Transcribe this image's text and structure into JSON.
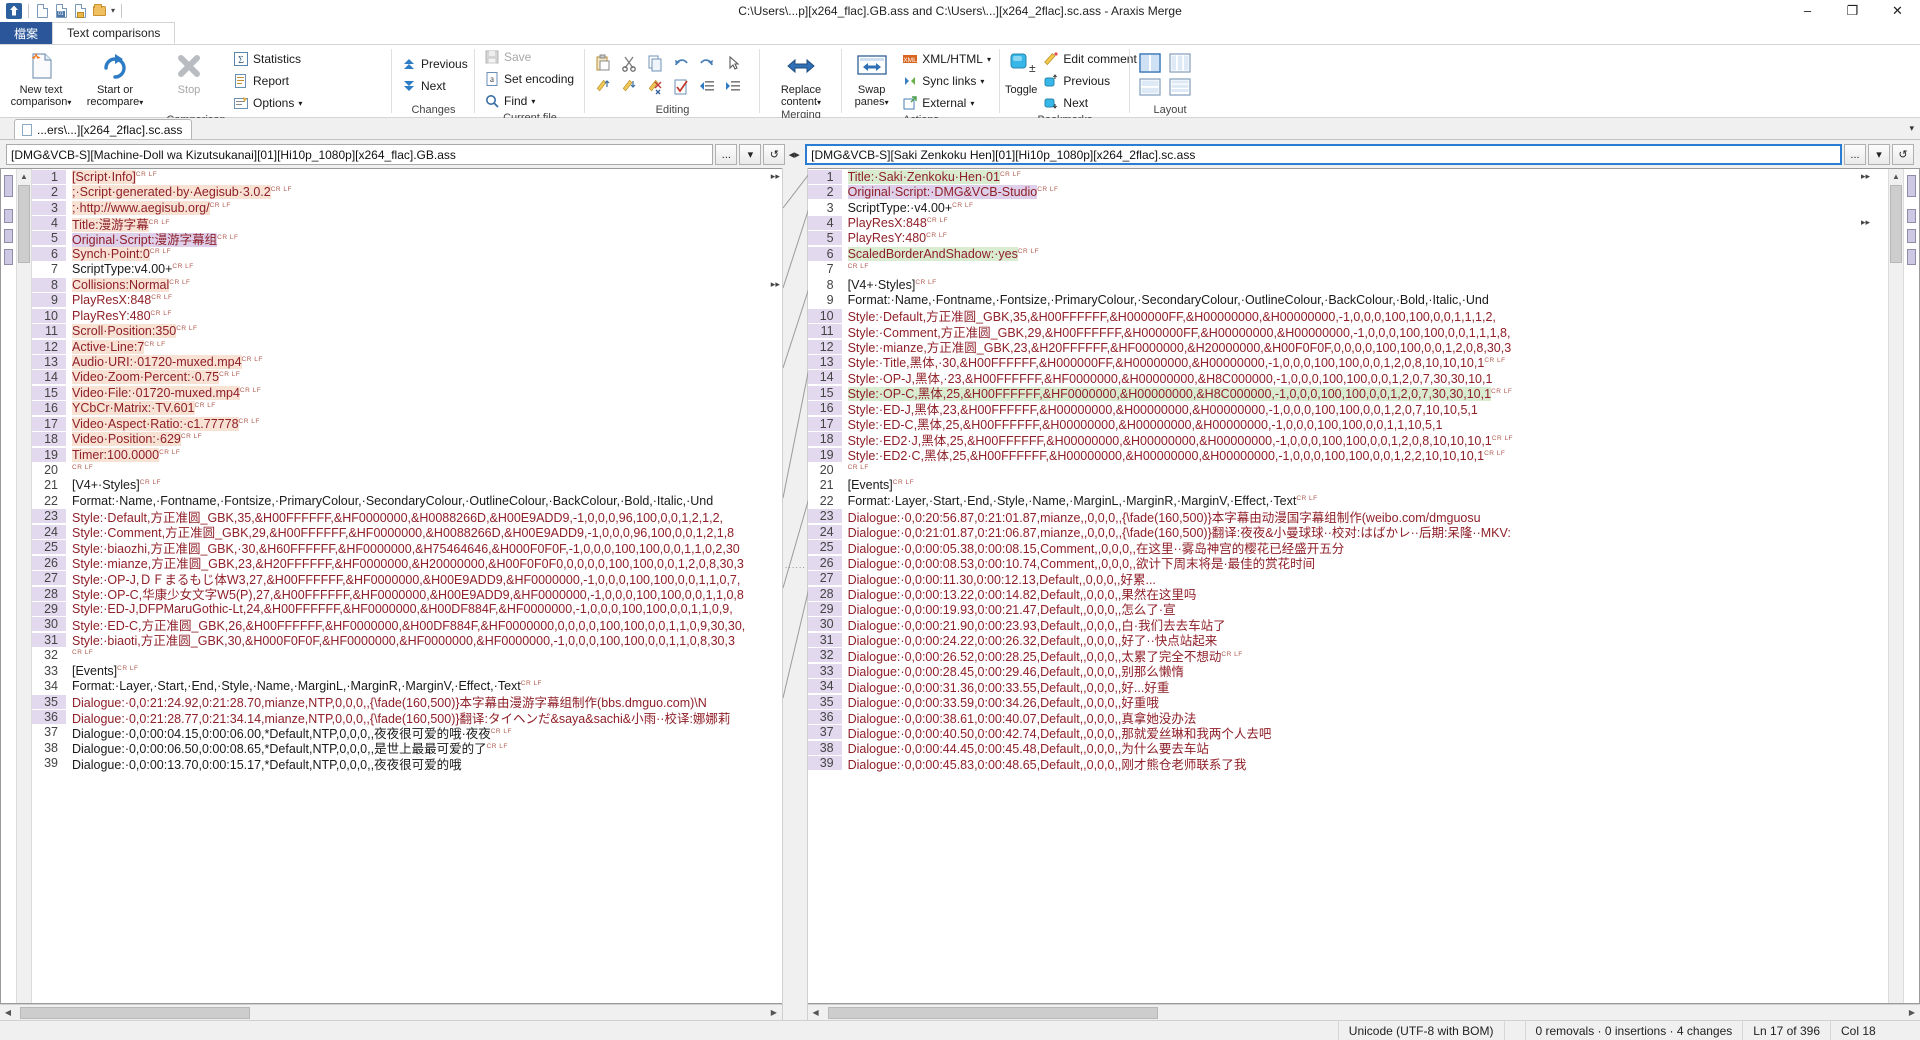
{
  "window": {
    "title": "C:\\Users\\...p][x264_flac].GB.ass and C:\\Users\\...][x264_2flac].sc.ass - Araxis Merge",
    "minimize": "–",
    "maximize": "❐",
    "close": "✕"
  },
  "ribbon_tabs": {
    "file": "檔案",
    "text_comparisons": "Text comparisons"
  },
  "ribbon": {
    "groups": [
      {
        "label": "Comparison",
        "big_buttons": [
          {
            "name": "new-text-comparison",
            "line1": "New text",
            "line2": "comparison",
            "caret": "▾",
            "disabled": false
          },
          {
            "name": "start-or-recompare",
            "line1": "Start or",
            "line2": "recompare",
            "caret": "▾",
            "disabled": false
          },
          {
            "name": "stop",
            "line1": "Stop",
            "line2": "",
            "caret": "",
            "disabled": true
          }
        ],
        "small_items": [
          {
            "label": "Statistics",
            "icon": "sigma-icon",
            "caret": ""
          },
          {
            "label": "Report",
            "icon": "report-icon",
            "caret": ""
          },
          {
            "label": "Options",
            "icon": "options-icon",
            "caret": "▾"
          }
        ]
      },
      {
        "label": "Changes",
        "small_items": [
          {
            "label": "Previous",
            "icon": "arrow-up-icon",
            "caret": ""
          },
          {
            "label": "Next",
            "icon": "arrow-down-icon",
            "caret": ""
          }
        ]
      },
      {
        "label": "Current file",
        "small_items": [
          {
            "label": "Save",
            "icon": "save-icon",
            "caret": "",
            "disabled": true
          },
          {
            "label": "Set encoding",
            "icon": "encoding-icon",
            "caret": ""
          },
          {
            "label": "Find",
            "icon": "search-icon",
            "caret": "▾"
          }
        ]
      },
      {
        "label": "Editing",
        "icons": [
          "paste-icon",
          "cut-icon",
          "copy-icon",
          "undo-icon",
          "redo-icon",
          "select-icon",
          "edit-up-icon",
          "edit-down-icon",
          "edit-clear-icon",
          "check-edit-icon",
          "outdent-icon",
          "indent-icon"
        ]
      },
      {
        "label": "Merging",
        "big_buttons": [
          {
            "name": "replace-content",
            "line1": "Replace",
            "line2": "content",
            "caret": "▾",
            "disabled": false
          }
        ]
      },
      {
        "label": "Actions",
        "big_buttons": [
          {
            "name": "swap-panes",
            "line1": "Swap",
            "line2": "panes",
            "caret": "▾",
            "disabled": false
          }
        ],
        "small_items": [
          {
            "label": "XML/HTML",
            "icon": "xml-icon",
            "caret": "▾"
          },
          {
            "label": "Sync links",
            "icon": "sync-links-icon",
            "caret": "▾"
          },
          {
            "label": "External",
            "icon": "external-icon",
            "caret": "▾"
          }
        ]
      },
      {
        "label": "Bookmarks",
        "big_buttons": [
          {
            "name": "toggle-bookmark",
            "line1": "Toggle",
            "line2": "",
            "caret": "",
            "disabled": false
          }
        ],
        "small_items": [
          {
            "label": "Edit comment",
            "icon": "edit-comment-icon",
            "caret": ""
          },
          {
            "label": "Previous",
            "icon": "bookmark-prev-icon",
            "caret": ""
          },
          {
            "label": "Next",
            "icon": "bookmark-next-icon",
            "caret": ""
          }
        ]
      },
      {
        "label": "Layout",
        "icons": [
          "two-pane-icon",
          "three-pane-icon",
          "split-horizontal-icon",
          "stacked-icon"
        ]
      }
    ]
  },
  "file_tab": {
    "label": "...ers\\...][x264_2flac].sc.ass",
    "icon": "document-icon"
  },
  "paths": {
    "left": {
      "value": "[DMG&VCB-S][Machine-Doll wa Kizutsukanai][01][Hi10p_1080p][x264_flac].GB.ass",
      "browse": "...",
      "dropdown": "▾",
      "refresh": "↺"
    },
    "right": {
      "value": "[DMG&VCB-S][Saki Zenkoku Hen][01][Hi10p_1080p][x264_2flac].sc.ass",
      "browse": "...",
      "dropdown": "▾",
      "refresh": "↺"
    },
    "swap_glyph": "◂▸"
  },
  "left_pane": {
    "lines": [
      {
        "n": "1",
        "text": "[Script·Info]",
        "crlf": true,
        "state": "chg",
        "hl": "hl"
      },
      {
        "n": "2",
        "text": ";·Script·generated·by·Aegisub·3.0.2",
        "crlf": true,
        "state": "chg",
        "hl": "hl"
      },
      {
        "n": "3",
        "text": ";·http://www.aegisub.org/",
        "crlf": true,
        "state": "chg",
        "hl": "hl"
      },
      {
        "n": "4",
        "text": "Title:漫游字幕",
        "crlf": true,
        "state": "chg",
        "hl": "hl"
      },
      {
        "n": "5",
        "text": "Original·Script:漫游字幕组",
        "crlf": true,
        "state": "chg",
        "hl": "hl2"
      },
      {
        "n": "6",
        "text": "Synch·Point:0",
        "crlf": true,
        "state": "chg",
        "hl": "hl"
      },
      {
        "n": "7",
        "text": "ScriptType:v4.00+",
        "crlf": true,
        "state": "same",
        "hl": ""
      },
      {
        "n": "8",
        "text": "Collisions:Normal",
        "crlf": true,
        "state": "chg",
        "hl": "hl"
      },
      {
        "n": "9",
        "text": "PlayResX:848",
        "crlf": true,
        "state": "chg",
        "hl": ""
      },
      {
        "n": "10",
        "text": "PlayResY:480",
        "crlf": true,
        "state": "chg",
        "hl": ""
      },
      {
        "n": "11",
        "text": "Scroll·Position:350",
        "crlf": true,
        "state": "chg",
        "hl": "hl"
      },
      {
        "n": "12",
        "text": "Active·Line:7",
        "crlf": true,
        "state": "chg",
        "hl": "hl"
      },
      {
        "n": "13",
        "text": "Audio·URI:·01720-muxed.mp4",
        "crlf": true,
        "state": "chg",
        "hl": "hl"
      },
      {
        "n": "14",
        "text": "Video·Zoom·Percent:·0.75",
        "crlf": true,
        "state": "chg",
        "hl": "hl"
      },
      {
        "n": "15",
        "text": "Video·File:·01720-muxed.mp4",
        "crlf": true,
        "state": "chg",
        "hl": "hl"
      },
      {
        "n": "16",
        "text": "YCbCr·Matrix:·TV.601",
        "crlf": true,
        "state": "chg",
        "hl": "hl"
      },
      {
        "n": "17",
        "text": "Video·Aspect·Ratio:·c1.77778",
        "crlf": true,
        "state": "chg",
        "hl": "hl"
      },
      {
        "n": "18",
        "text": "Video·Position:·629",
        "crlf": true,
        "state": "chg",
        "hl": "hl"
      },
      {
        "n": "19",
        "text": "Timer:100.0000",
        "crlf": true,
        "state": "chg",
        "hl": "hl"
      },
      {
        "n": "20",
        "text": "",
        "crlf": true,
        "state": "same",
        "hl": ""
      },
      {
        "n": "21",
        "text": "[V4+·Styles]",
        "crlf": true,
        "state": "same",
        "hl": ""
      },
      {
        "n": "22",
        "text": "Format:·Name,·Fontname,·Fontsize,·PrimaryColour,·SecondaryColour,·OutlineColour,·BackColour,·Bold,·Italic,·Und",
        "crlf": false,
        "state": "same",
        "hl": ""
      },
      {
        "n": "23",
        "text": "Style:·Default,方正准圆_GBK,35,&H00FFFFFF,&HF0000000,&H0088266D,&H00E9ADD9,-1,0,0,0,96,100,0,0,1,2,1,2,",
        "crlf": false,
        "state": "chg",
        "hl": ""
      },
      {
        "n": "24",
        "text": "Style:·Comment,方正准圆_GBK,29,&H00FFFFFF,&HF0000000,&H0088266D,&H00E9ADD9,-1,0,0,0,96,100,0,0,1,2,1,8",
        "crlf": false,
        "state": "chg",
        "hl": ""
      },
      {
        "n": "25",
        "text": "Style:·biaozhi,方正准圆_GBK,·30,&H60FFFFFF,&HF0000000,&H75464646,&H000F0F0F,-1,0,0,0,100,100,0,0,1,1,0,2,30",
        "crlf": false,
        "state": "chg",
        "hl": ""
      },
      {
        "n": "26",
        "text": "Style:·mianze,方正准圆_GBK,23,&H20FFFFFF,&HF0000000,&H20000000,&H00F0F0F0,0,0,0,0,100,100,0,0,1,2,0,8,30,3",
        "crlf": false,
        "state": "chg",
        "hl": ""
      },
      {
        "n": "27",
        "text": "Style:·OP-J,ＤＦまるもじ体W3,27,&H00FFFFFF,&HF0000000,&H00E9ADD9,&HF0000000,-1,0,0,0,100,100,0,0,1,1,0,7,",
        "crlf": false,
        "state": "chg",
        "hl": ""
      },
      {
        "n": "28",
        "text": "Style:·OP-C,华康少女文字W5(P),27,&H00FFFFFF,&HF0000000,&H00E9ADD9,&HF0000000,-1,0,0,0,100,100,0,0,1,1,0,8",
        "crlf": false,
        "state": "chg",
        "hl": ""
      },
      {
        "n": "29",
        "text": "Style:·ED-J,DFPMaruGothic-Lt,24,&H00FFFFFF,&HF0000000,&H00DF884F,&HF0000000,-1,0,0,0,100,100,0,0,1,1,0,9,",
        "crlf": false,
        "state": "chg",
        "hl": ""
      },
      {
        "n": "30",
        "text": "Style:·ED-C,方正准圆_GBK,26,&H00FFFFFF,&HF0000000,&H00DF884F,&HF0000000,0,0,0,0,100,100,0,0,1,1,0,9,30,30,",
        "crlf": false,
        "state": "chg",
        "hl": ""
      },
      {
        "n": "31",
        "text": "Style:·biaoti,方正准圆_GBK,30,&H000F0F0F,&HF0000000,&HF0000000,&HF0000000,-1,0,0,0,100,100,0,0,1,1,0,8,30,3",
        "crlf": false,
        "state": "chg",
        "hl": ""
      },
      {
        "n": "32",
        "text": "",
        "crlf": true,
        "state": "same",
        "hl": ""
      },
      {
        "n": "33",
        "text": "[Events]",
        "crlf": true,
        "state": "same",
        "hl": ""
      },
      {
        "n": "34",
        "text": "Format:·Layer,·Start,·End,·Style,·Name,·MarginL,·MarginR,·MarginV,·Effect,·Text",
        "crlf": true,
        "state": "same",
        "hl": ""
      },
      {
        "n": "35",
        "text": "Dialogue:·0,0:21:24.92,0:21:28.70,mianze,NTP,0,0,0,,{\\fade(160,500)}本字幕由漫游字幕组制作(bbs.dmguo.com)\\N",
        "crlf": false,
        "state": "chg",
        "hl": ""
      },
      {
        "n": "36",
        "text": "Dialogue:·0,0:21:28.77,0:21:34.14,mianze,NTP,0,0,0,,{\\fade(160,500)}翻译:タイヘンだ&saya&sachi&小雨··校译:娜娜莉",
        "crlf": false,
        "state": "chg",
        "hl": ""
      },
      {
        "n": "37",
        "text": "Dialogue:·0,0:00:04.15,0:00:06.00,*Default,NTP,0,0,0,,夜夜很可爱的哦·夜夜",
        "crlf": true,
        "state": "same",
        "hl": ""
      },
      {
        "n": "38",
        "text": "Dialogue:·0,0:00:06.50,0:00:08.65,*Default,NTP,0,0,0,,是世上最最可爱的了",
        "crlf": true,
        "state": "same",
        "hl": ""
      },
      {
        "n": "39",
        "text": "Dialogue:·0,0:00:13.70,0:00:15.17,*Default,NTP,0,0,0,,夜夜很可爱的哦",
        "crlf": false,
        "state": "same",
        "hl": ""
      }
    ]
  },
  "right_pane": {
    "lines": [
      {
        "n": "1",
        "text": "Title:·Saki·Zenkoku·Hen·01",
        "crlf": true,
        "state": "chg",
        "hl": "hlg"
      },
      {
        "n": "2",
        "text": "Original·Script:·DMG&VCB-Studio",
        "crlf": true,
        "state": "chg",
        "hl": "hl2"
      },
      {
        "n": "3",
        "text": "ScriptType:·v4.00+",
        "crlf": true,
        "state": "same",
        "hl": ""
      },
      {
        "n": "4",
        "text": "PlayResX:848",
        "crlf": true,
        "state": "chg",
        "hl": ""
      },
      {
        "n": "5",
        "text": "PlayResY:480",
        "crlf": true,
        "state": "chg",
        "hl": ""
      },
      {
        "n": "6",
        "text": "ScaledBorderAndShadow:·yes",
        "crlf": true,
        "state": "chg",
        "hl": "hlg"
      },
      {
        "n": "7",
        "text": "",
        "crlf": true,
        "state": "same",
        "hl": ""
      },
      {
        "n": "8",
        "text": "[V4+·Styles]",
        "crlf": true,
        "state": "same",
        "hl": ""
      },
      {
        "n": "9",
        "text": "Format:·Name,·Fontname,·Fontsize,·PrimaryColour,·SecondaryColour,·OutlineColour,·BackColour,·Bold,·Italic,·Und",
        "crlf": false,
        "state": "same",
        "hl": ""
      },
      {
        "n": "10",
        "text": "Style:·Default,方正准圆_GBK,35,&H00FFFFFF,&H000000FF,&H00000000,&H00000000,-1,0,0,0,100,100,0,0,1,1,1,2,",
        "crlf": false,
        "state": "chg",
        "hl": ""
      },
      {
        "n": "11",
        "text": "Style:·Comment,方正准圆_GBK,29,&H00FFFFFF,&H000000FF,&H00000000,&H00000000,-1,0,0,0,100,100,0,0,1,1,1,8,",
        "crlf": false,
        "state": "chg",
        "hl": ""
      },
      {
        "n": "12",
        "text": "Style:·mianze,方正准圆_GBK,23,&H20FFFFFF,&HF0000000,&H20000000,&H00F0F0F,0,0,0,0,100,100,0,0,1,2,0,8,30,3",
        "crlf": false,
        "state": "chg",
        "hl": ""
      },
      {
        "n": "13",
        "text": "Style:·Title,黑体,·30,&H00FFFFFF,&H000000FF,&H00000000,&H00000000,-1,0,0,0,100,100,0,0,1,2,0,8,10,10,10,1",
        "crlf": true,
        "state": "chg",
        "hl": ""
      },
      {
        "n": "14",
        "text": "Style:·OP-J,黑体,·23,&H00FFFFFF,&HF0000000,&H00000000,&H8C000000,-1,0,0,0,100,100,0,0,1,2,0,7,30,30,10,1",
        "crlf": false,
        "state": "chg",
        "hl": ""
      },
      {
        "n": "15",
        "text": "Style:·OP-C,黑体,25,&H00FFFFFF,&HF0000000,&H00000000,&H8C000000,-1,0,0,0,100,100,0,0,1,2,0,7,30,30,10,1",
        "crlf": true,
        "state": "chg",
        "hl": "hlg"
      },
      {
        "n": "16",
        "text": "Style:·ED-J,黑体,23,&H00FFFFFF,&H00000000,&H00000000,&H00000000,-1,0,0,0,100,100,0,0,1,2,0,7,10,10,5,1",
        "crlf": false,
        "state": "chg",
        "hl": ""
      },
      {
        "n": "17",
        "text": "Style:·ED-C,黑体,25,&H00FFFFFF,&H00000000,&H00000000,&H00000000,-1,0,0,0,100,100,0,0,1,1,10,5,1",
        "crlf": false,
        "state": "chg",
        "hl": ""
      },
      {
        "n": "18",
        "text": "Style:·ED2·J,黑体,25,&H00FFFFFF,&H00000000,&H00000000,&H00000000,-1,0,0,0,100,100,0,0,1,2,0,8,10,10,10,1",
        "crlf": true,
        "state": "chg",
        "hl": ""
      },
      {
        "n": "19",
        "text": "Style:·ED2·C,黑体,25,&H00FFFFFF,&H00000000,&H00000000,&H00000000,-1,0,0,0,100,100,0,0,1,2,2,10,10,10,1",
        "crlf": true,
        "state": "chg",
        "hl": ""
      },
      {
        "n": "20",
        "text": "",
        "crlf": true,
        "state": "same",
        "hl": ""
      },
      {
        "n": "21",
        "text": "[Events]",
        "crlf": true,
        "state": "same",
        "hl": ""
      },
      {
        "n": "22",
        "text": "Format:·Layer,·Start,·End,·Style,·Name,·MarginL,·MarginR,·MarginV,·Effect,·Text",
        "crlf": true,
        "state": "same",
        "hl": ""
      },
      {
        "n": "23",
        "text": "Dialogue:·0,0:20:56.87,0:21:01.87,mianze,,0,0,0,,{\\fade(160,500)}本字幕由动漫国字幕组制作(weibo.com/dmguosu",
        "crlf": false,
        "state": "chg",
        "hl": ""
      },
      {
        "n": "24",
        "text": "Dialogue:·0,0:21:01.87,0:21:06.87,mianze,,0,0,0,,{\\fade(160,500)}翻译:夜夜&小曼球球··校对:はばかレ··后期:呆隆··MKV:",
        "crlf": false,
        "state": "chg",
        "hl": ""
      },
      {
        "n": "25",
        "text": "Dialogue:·0,0:00:05.38,0:00:08.15,Comment,,0,0,0,,在这里··雾岛神宫的樱花已经盛开五分",
        "crlf": false,
        "state": "chg",
        "hl": ""
      },
      {
        "n": "26",
        "text": "Dialogue:·0,0:00:08.53,0:00:10.74,Comment,,0,0,0,,欲计下周末将是·最佳的赏花时间",
        "crlf": false,
        "state": "chg",
        "hl": ""
      },
      {
        "n": "27",
        "text": "Dialogue:·0,0:00:11.30,0:00:12.13,Default,,0,0,0,,好累...",
        "crlf": false,
        "state": "chg",
        "hl": ""
      },
      {
        "n": "28",
        "text": "Dialogue:·0,0:00:13.22,0:00:14.82,Default,,0,0,0,,果然在这里吗",
        "crlf": false,
        "state": "chg",
        "hl": ""
      },
      {
        "n": "29",
        "text": "Dialogue:·0,0:00:19.93,0:00:21.47,Default,,0,0,0,,怎么了·宣",
        "crlf": false,
        "state": "chg",
        "hl": ""
      },
      {
        "n": "30",
        "text": "Dialogue:·0,0:00:21.90,0:00:23.93,Default,,0,0,0,,白·我们去去车站了",
        "crlf": false,
        "state": "chg",
        "hl": ""
      },
      {
        "n": "31",
        "text": "Dialogue:·0,0:00:24.22,0:00:26.32,Default,,0,0,0,,好了··快点站起来",
        "crlf": false,
        "state": "chg",
        "hl": ""
      },
      {
        "n": "32",
        "text": "Dialogue:·0,0:00:26.52,0:00:28.25,Default,,0,0,0,,太累了完全不想动",
        "crlf": true,
        "state": "chg",
        "hl": ""
      },
      {
        "n": "33",
        "text": "Dialogue:·0,0:00:28.45,0:00:29.46,Default,,0,0,0,,别那么懒惰",
        "crlf": false,
        "state": "chg",
        "hl": ""
      },
      {
        "n": "34",
        "text": "Dialogue:·0,0:00:31.36,0:00:33.55,Default,,0,0,0,,好...好重",
        "crlf": false,
        "state": "chg",
        "hl": ""
      },
      {
        "n": "35",
        "text": "Dialogue:·0,0:00:33.59,0:00:34.26,Default,,0,0,0,,好重哦",
        "crlf": false,
        "state": "chg",
        "hl": ""
      },
      {
        "n": "36",
        "text": "Dialogue:·0,0:00:38.61,0:00:40.07,Default,,0,0,0,,真拿她没办法",
        "crlf": false,
        "state": "chg",
        "hl": ""
      },
      {
        "n": "37",
        "text": "Dialogue:·0,0:00:40.50,0:00:42.74,Default,,0,0,0,,那就爱丝琳和我两个人去吧",
        "crlf": false,
        "state": "chg",
        "hl": ""
      },
      {
        "n": "38",
        "text": "Dialogue:·0,0:00:44.45,0:00:45.48,Default,,0,0,0,,为什么要去车站",
        "crlf": false,
        "state": "chg",
        "hl": ""
      },
      {
        "n": "39",
        "text": "Dialogue:·0,0:00:45.83,0:00:48.65,Default,,0,0,0,,刚才熊仓老师联系了我",
        "crlf": false,
        "state": "chg",
        "hl": ""
      }
    ]
  },
  "status": {
    "encoding": "Unicode (UTF-8 with BOM)",
    "changes": "0 removals · 0 insertions · 4 changes",
    "line": "Ln 17 of 396",
    "col": "Col 18"
  }
}
